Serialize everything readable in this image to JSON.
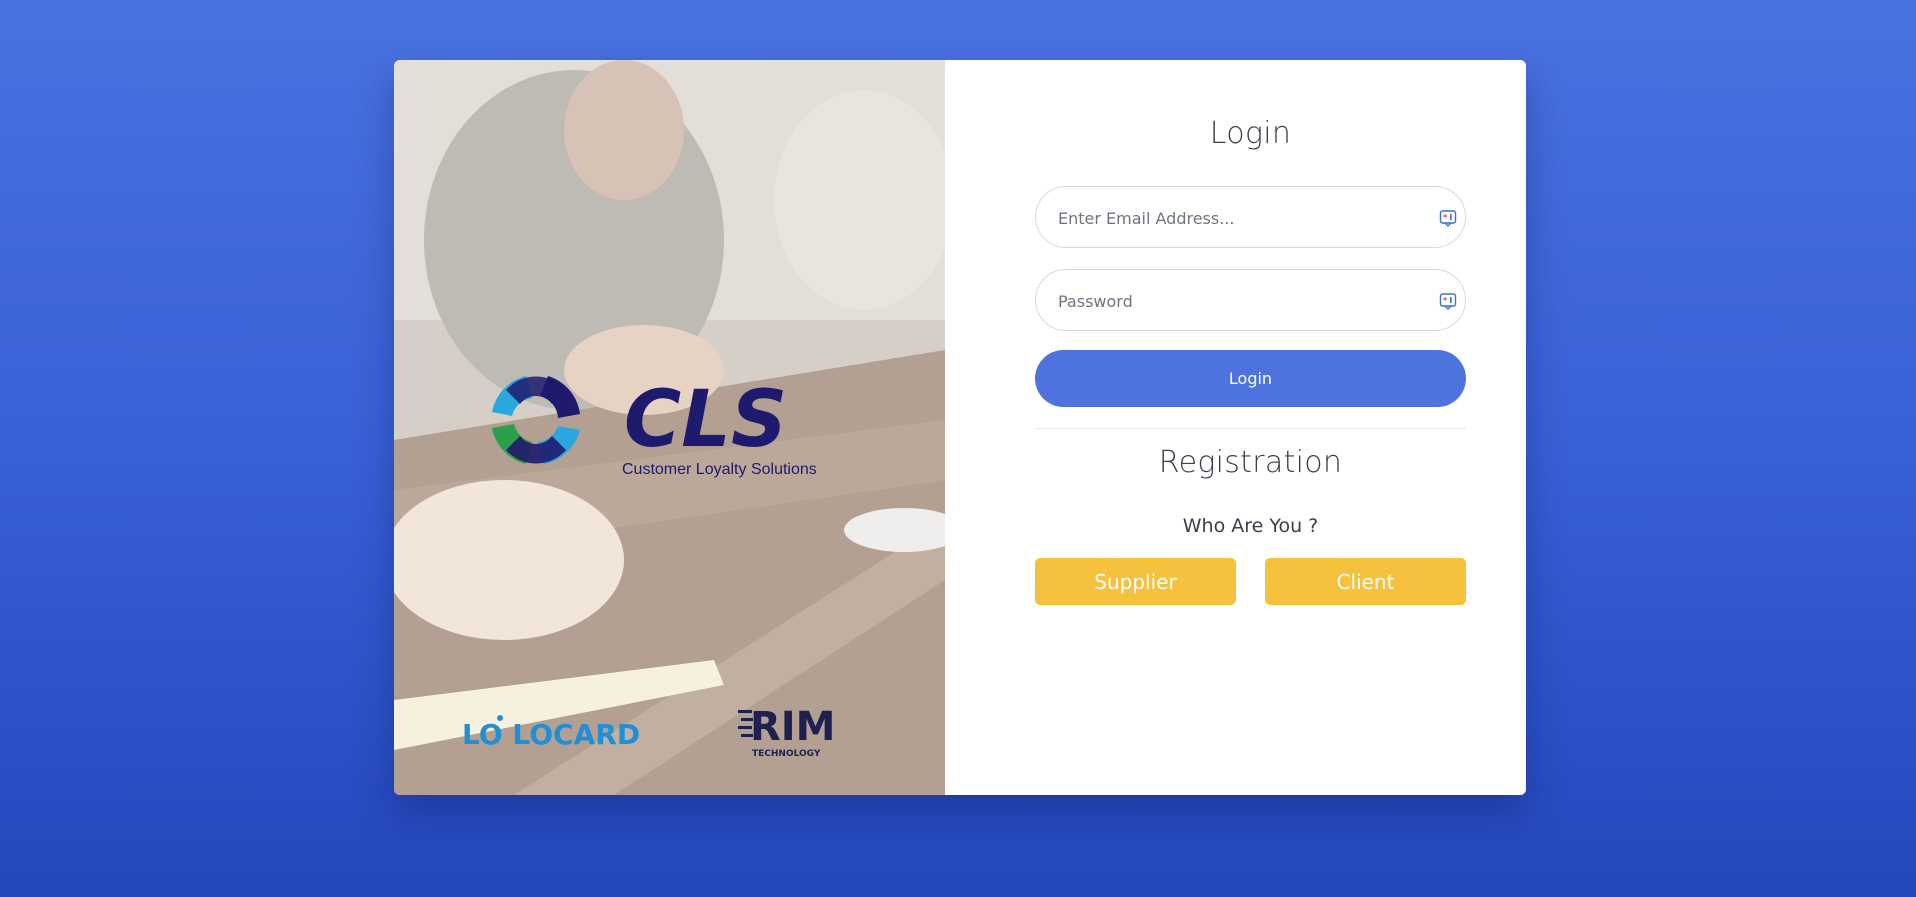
{
  "brand": {
    "cls_logo_text": "CLS",
    "cls_logo_tagline": "Customer Loyalty Solutions",
    "locard_logo_text": "LO LOCARD",
    "rim_logo_text": "RIM",
    "rim_logo_subtext": "TECHNOLOGY"
  },
  "login": {
    "title": "Login",
    "email_placeholder": "Enter Email Address...",
    "password_placeholder": "Password",
    "submit_label": "Login"
  },
  "registration": {
    "title": "Registration",
    "prompt": "Who Are You ?",
    "supplier_label": "Supplier",
    "client_label": "Client"
  },
  "icons": {
    "email_field_icon": "password-manager-icon",
    "password_field_icon": "password-manager-icon"
  },
  "colors": {
    "background_top": "#4a72e0",
    "background_bottom": "#2447bc",
    "primary_button": "#4e73df",
    "role_button": "#f6c23e",
    "cls_navy": "#1e1a6e",
    "cls_teal": "#29a8e0",
    "cls_green": "#2aa148",
    "locard_blue": "#1f8fd6"
  }
}
